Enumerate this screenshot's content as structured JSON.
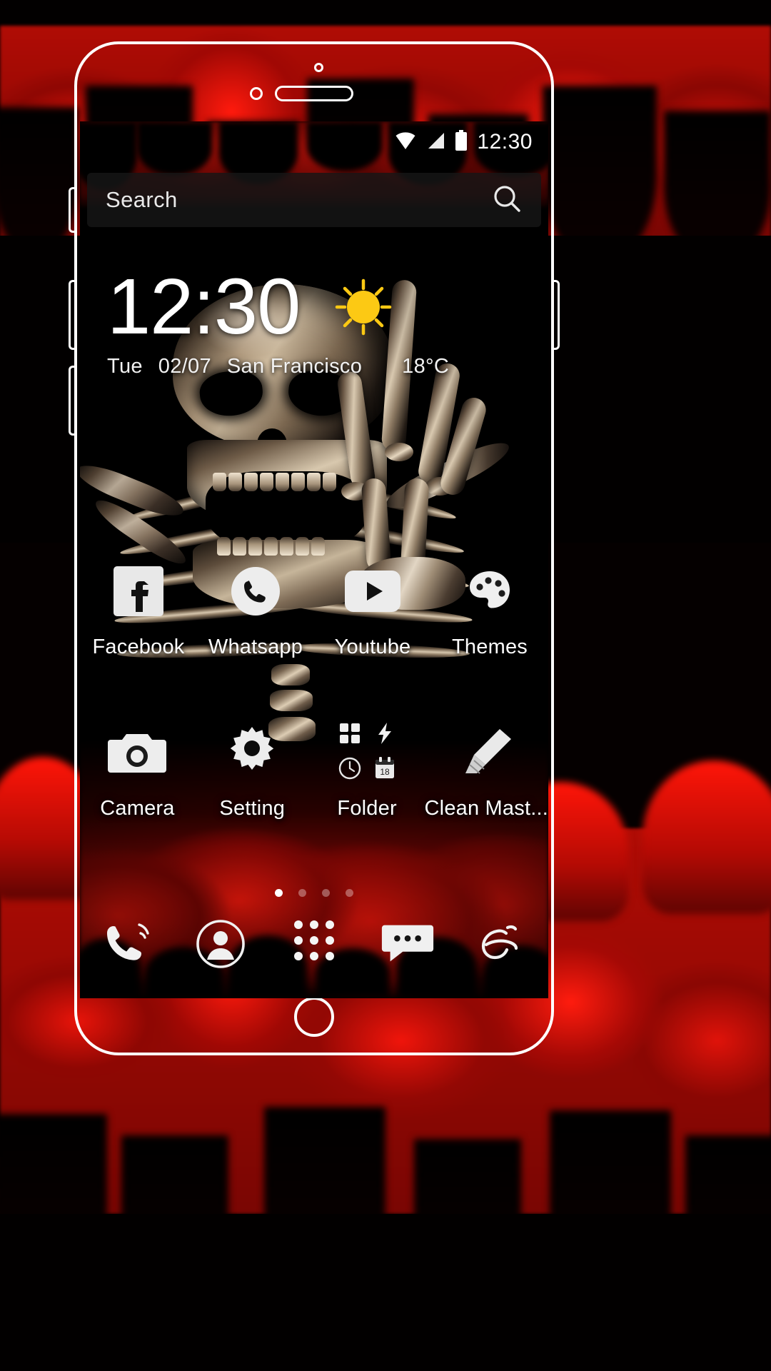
{
  "statusbar": {
    "time": "12:30",
    "icons": [
      "wifi-icon",
      "signal-icon",
      "battery-icon"
    ]
  },
  "search": {
    "placeholder": "Search",
    "icon": "search-icon"
  },
  "clock_widget": {
    "time": "12:30",
    "weather_icon": "sun-icon",
    "day": "Tue",
    "date": "02/07",
    "city": "San Francisco",
    "temperature": "18°C"
  },
  "apps": {
    "row1": [
      {
        "label": "Facebook",
        "icon": "facebook-icon"
      },
      {
        "label": "Whatsapp",
        "icon": "whatsapp-phone-icon"
      },
      {
        "label": "Youtube",
        "icon": "youtube-icon"
      },
      {
        "label": "Themes",
        "icon": "themes-icon"
      }
    ],
    "row2": [
      {
        "label": "Camera",
        "icon": "camera-icon"
      },
      {
        "label": "Setting",
        "icon": "gear-icon"
      },
      {
        "label": "Folder",
        "icon": "folder-icon",
        "contents": [
          "apps-grid-icon",
          "flash-icon",
          "clock-icon",
          "calendar-icon"
        ],
        "calendar_day": "18"
      },
      {
        "label": "Clean Mast...",
        "icon": "clean-master-icon"
      }
    ]
  },
  "page_indicator": {
    "total": 4,
    "active": 1
  },
  "dock": [
    {
      "icon": "phone-dialer-icon"
    },
    {
      "icon": "contacts-icon"
    },
    {
      "icon": "app-drawer-icon"
    },
    {
      "icon": "messages-icon"
    },
    {
      "icon": "browser-icon"
    }
  ],
  "phone_frame": {
    "earpiece": "earpiece-speaker",
    "front_camera": "front-camera",
    "sensor": "proximity-sensor",
    "home_button": "home-button"
  },
  "colors": {
    "blood_red": "#d4120a",
    "background_black": "#000000",
    "sun_yellow": "#fcc914",
    "text_white": "#ffffff",
    "search_bar_bg": "#161616"
  }
}
